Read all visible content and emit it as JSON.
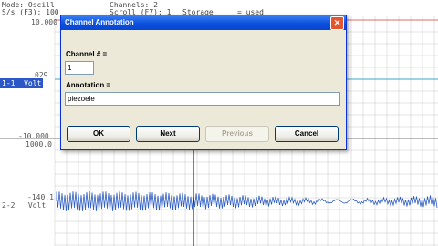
{
  "status": {
    "mode": "Mode: Oscill",
    "channels": "Channels: 2",
    "sample_rate": "S/s (F3): 100",
    "partial_1": "Scroll (F7): 1",
    "partial_2": "Storage",
    "partial_3": "= used"
  },
  "axes": {
    "ch1_top": "10.000",
    "ch1_mid": "029",
    "ch1_bottom": "-10.000",
    "ch1_unit": "Volt",
    "ch2_top": "1000.0",
    "ch2_mid": "-140.1",
    "ch2_unit": "Volt"
  },
  "channels": [
    {
      "label": "1-1",
      "active": true
    },
    {
      "label": "2-2",
      "active": false
    }
  ],
  "colors": {
    "grid": "#c8c8c8",
    "trace_ch1": "#3aa8c8",
    "trace_ch1_line": "#e06a6a",
    "trace_ch2": "#2f5fc4",
    "active_channel": "#2b57c8",
    "cursor": "#000000"
  },
  "dialog": {
    "title": "Channel Annotation",
    "channel_label": "Channel # =",
    "channel_value": "1",
    "annotation_label": "Annotation =",
    "annotation_value": "piezoele",
    "buttons": {
      "ok": "OK",
      "next": "Next",
      "previous": "Previous",
      "cancel": "Cancel"
    }
  }
}
